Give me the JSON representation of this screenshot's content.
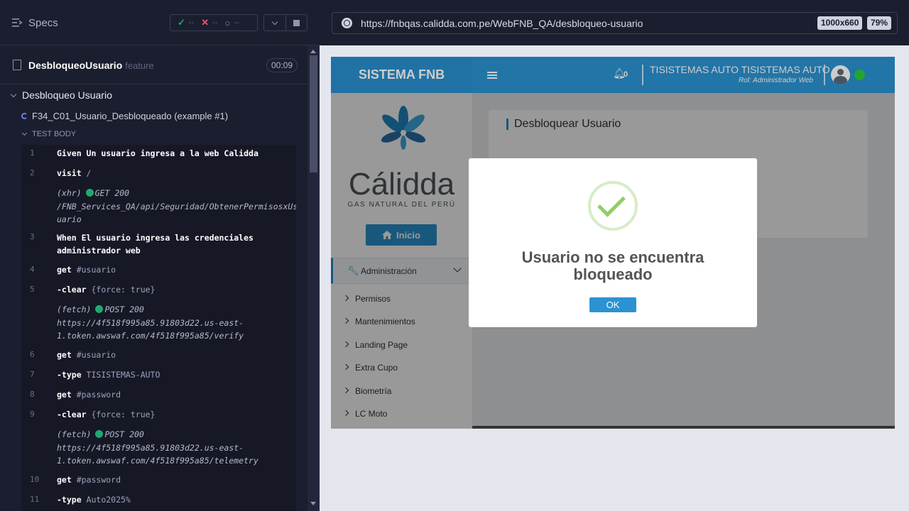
{
  "runner": {
    "specs_label": "Specs",
    "stats": {
      "passed": "--",
      "failed": "--",
      "pending": "--"
    },
    "spec_file": "DesbloqueoUsuario",
    "spec_ext": "feature",
    "duration": "00:09",
    "suite": "Desbloqueo Usuario",
    "test_title": "F34_C01_Usuario_Desbloqueado (example #1)",
    "test_body": "TEST BODY",
    "commands": [
      {
        "num": "1",
        "cmd": "Given",
        "arg": " Un usuario ingresa a la web Calidda"
      },
      {
        "num": "2",
        "cmd": "visit",
        "arg": " /"
      },
      {
        "num": "",
        "kind": "(xhr)",
        "method": "GET 200",
        "url": "/FNB_Services_QA/api/Seguridad/ObtenerPermisosxUsuario"
      },
      {
        "num": "3",
        "cmd": "When",
        "arg": " El usuario ingresa las credenciales administrador web"
      },
      {
        "num": "4",
        "cmd": "get",
        "arg": " #usuario"
      },
      {
        "num": "5",
        "cmd": "-clear",
        "arg": " {force: true}"
      },
      {
        "num": "",
        "kind": "(fetch)",
        "method": "POST 200",
        "url": "https://4f518f995a85.91803d22.us-east-1.token.awswaf.com/4f518f995a85/verify"
      },
      {
        "num": "6",
        "cmd": "get",
        "arg": " #usuario"
      },
      {
        "num": "7",
        "cmd": "-type",
        "arg": " TISISTEMAS-AUTO"
      },
      {
        "num": "8",
        "cmd": "get",
        "arg": " #password"
      },
      {
        "num": "9",
        "cmd": "-clear",
        "arg": " {force: true}"
      },
      {
        "num": "",
        "kind": "(fetch)",
        "method": "POST 200",
        "url": "https://4f518f995a85.91803d22.us-east-1.token.awswaf.com/4f518f995a85/telemetry"
      },
      {
        "num": "10",
        "cmd": "get",
        "arg": " #password"
      },
      {
        "num": "11",
        "cmd": "-type",
        "arg": " Auto2025%"
      }
    ],
    "colors": {
      "panel": "#1b1e2e",
      "passed": "#1fa971",
      "failed": "#e45770",
      "accent": "#6c7ee8"
    }
  },
  "browser": {
    "url": "https://fnbqas.calidda.com.pe/WebFNB_QA/desbloqueo-usuario",
    "viewport": "1000x660",
    "zoom": "79%"
  },
  "app": {
    "brand": "SISTEMA FNB",
    "bell_count": "0",
    "user_name": "TISISTEMAS AUTO TISISTEMAS AUTO",
    "user_role": "Rol: Administrador Web",
    "logo_text": "Cálidda",
    "logo_sub": "GAS NATURAL DEL PERÚ",
    "inicio_label": "Inicio",
    "menu_admin": "Administración",
    "submenu": [
      "Permisos",
      "Mantenimientos",
      "Landing Page",
      "Extra Cupo",
      "Biometría",
      "LC Moto"
    ],
    "card_title": "Desbloquear Usuario",
    "colors": {
      "primary": "#2b93d1",
      "online": "#2ecc40"
    }
  },
  "modal": {
    "message": "Usuario no se encuentra bloqueado",
    "ok_label": "OK",
    "icon": "success-check-icon"
  }
}
